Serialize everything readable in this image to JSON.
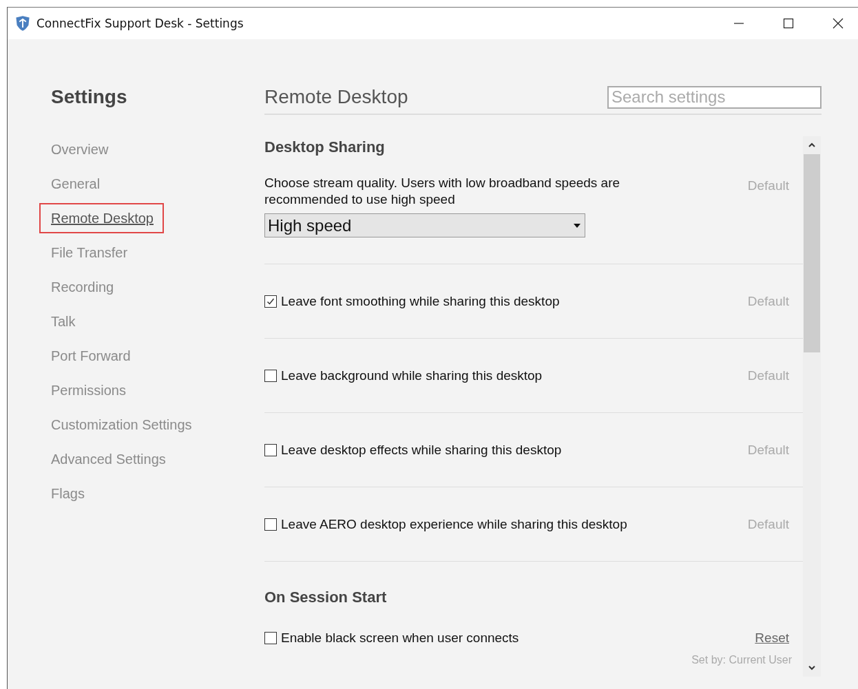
{
  "window": {
    "title": "ConnectFix Support Desk - Settings"
  },
  "sidebar": {
    "heading": "Settings",
    "items": [
      {
        "label": "Overview",
        "selected": false
      },
      {
        "label": "General",
        "selected": false
      },
      {
        "label": "Remote Desktop",
        "selected": true
      },
      {
        "label": "File Transfer",
        "selected": false
      },
      {
        "label": "Recording",
        "selected": false
      },
      {
        "label": "Talk",
        "selected": false
      },
      {
        "label": "Port Forward",
        "selected": false
      },
      {
        "label": "Permissions",
        "selected": false
      },
      {
        "label": "Customization Settings",
        "selected": false
      },
      {
        "label": "Advanced Settings",
        "selected": false
      },
      {
        "label": "Flags",
        "selected": false
      }
    ]
  },
  "page": {
    "title": "Remote Desktop",
    "search": {
      "placeholder": "Search settings"
    }
  },
  "sections": [
    {
      "heading": "Desktop Sharing",
      "settings": [
        {
          "kind": "dropdown",
          "label": "Choose stream quality. Users with low broadband speeds are recommended to use high speed",
          "value": "High speed",
          "action": {
            "kind": "default",
            "label": "Default"
          }
        },
        {
          "kind": "checkbox",
          "label": "Leave font smoothing while sharing this desktop",
          "checked": true,
          "action": {
            "kind": "default",
            "label": "Default"
          }
        },
        {
          "kind": "checkbox",
          "label": "Leave background while sharing this desktop",
          "checked": false,
          "action": {
            "kind": "default",
            "label": "Default"
          }
        },
        {
          "kind": "checkbox",
          "label": "Leave desktop effects while sharing this desktop",
          "checked": false,
          "action": {
            "kind": "default",
            "label": "Default"
          }
        },
        {
          "kind": "checkbox",
          "label": "Leave AERO desktop experience while sharing this desktop",
          "checked": false,
          "action": {
            "kind": "default",
            "label": "Default"
          }
        }
      ]
    },
    {
      "heading": "On Session Start",
      "settings": [
        {
          "kind": "checkbox",
          "label": "Enable black screen when user connects",
          "checked": false,
          "action": {
            "kind": "reset",
            "label": "Reset"
          },
          "note": "Set by: Current User"
        }
      ]
    }
  ]
}
